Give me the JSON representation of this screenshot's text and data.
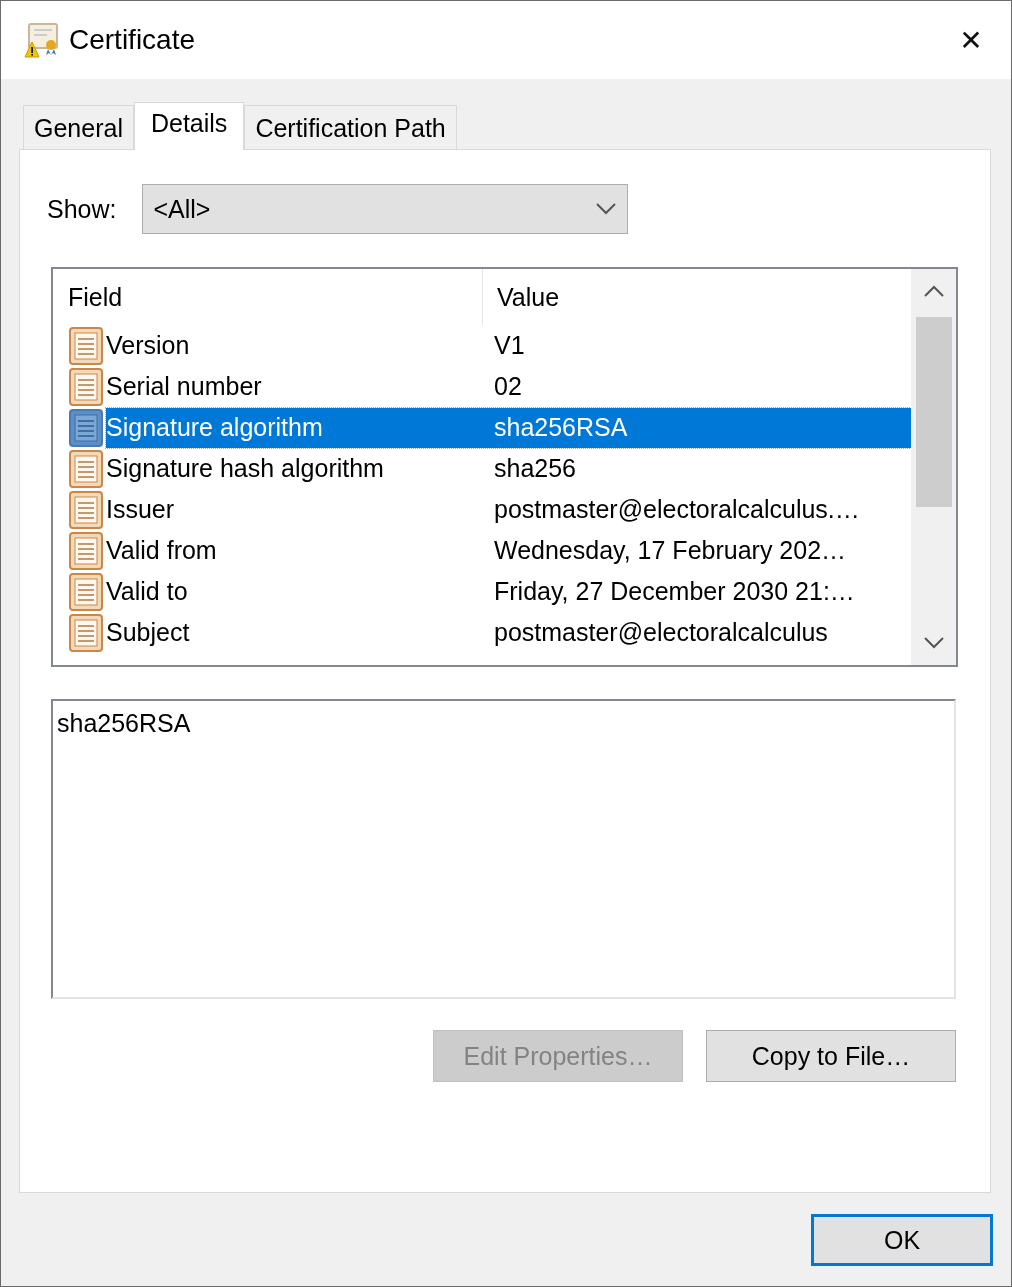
{
  "window": {
    "title": "Certificate",
    "close": "✕"
  },
  "tabs": [
    {
      "label": "General",
      "selected": false
    },
    {
      "label": "Details",
      "selected": true
    },
    {
      "label": "Certification Path",
      "selected": false
    }
  ],
  "show": {
    "label": "Show:",
    "value": "<All>"
  },
  "list": {
    "columns": [
      "Field",
      "Value"
    ],
    "rows": [
      {
        "field": "Version",
        "value": "V1",
        "selected": false
      },
      {
        "field": "Serial number",
        "value": "02",
        "selected": false
      },
      {
        "field": "Signature algorithm",
        "value": "sha256RSA",
        "selected": true
      },
      {
        "field": "Signature hash algorithm",
        "value": "sha256",
        "selected": false
      },
      {
        "field": "Issuer",
        "value": "postmaster@electoralcalculus.…",
        "selected": false
      },
      {
        "field": "Valid from",
        "value": "Wednesday, 17 February 202…",
        "selected": false
      },
      {
        "field": "Valid to",
        "value": "Friday, 27 December 2030 21:…",
        "selected": false
      },
      {
        "field": "Subject",
        "value": "postmaster@electoralcalculus",
        "selected": false
      }
    ]
  },
  "detail": {
    "text": "sha256RSA"
  },
  "buttons": [
    {
      "label": "Edit Properties…",
      "disabled": true
    },
    {
      "label": "Copy to File…",
      "disabled": false
    }
  ],
  "ok_button": {
    "label": "OK",
    "focused": true
  }
}
